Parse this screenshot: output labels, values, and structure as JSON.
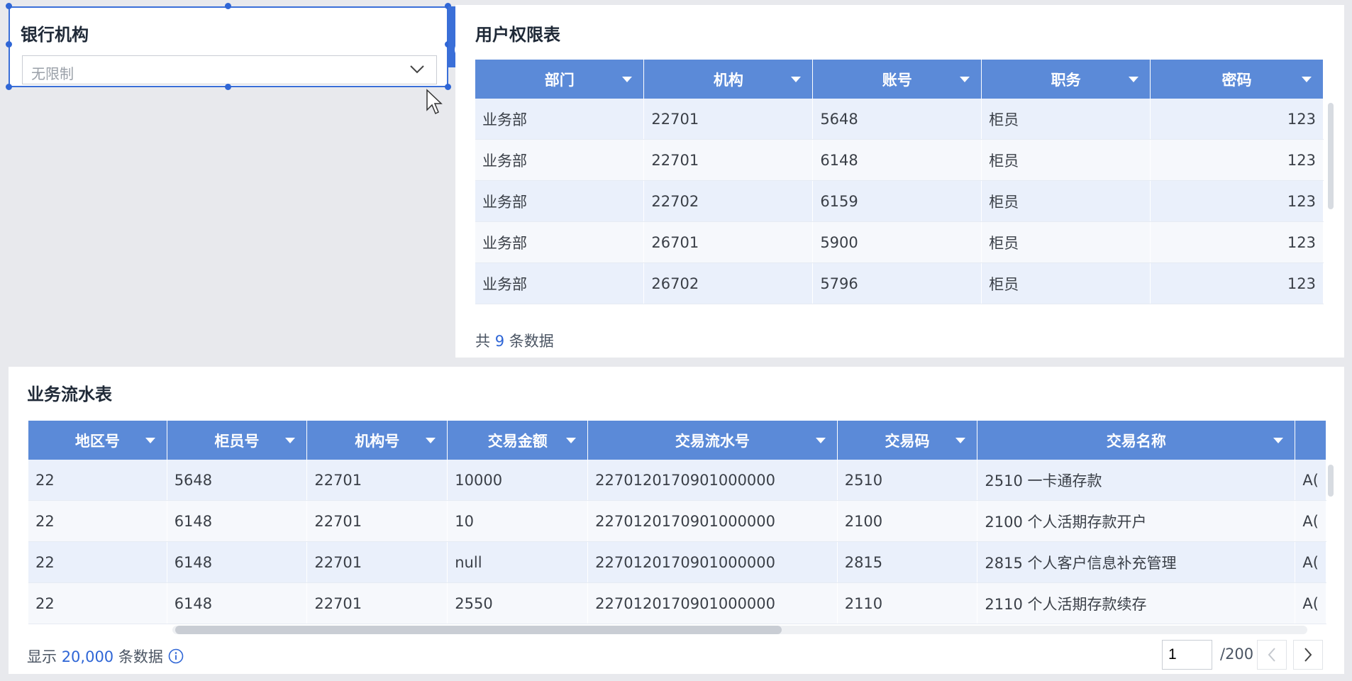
{
  "filter_widget": {
    "title": "银行机构",
    "selected_value": "无限制"
  },
  "user_table": {
    "title": "用户权限表",
    "columns": [
      "部门",
      "机构",
      "账号",
      "职务",
      "密码"
    ],
    "rows": [
      [
        "业务部",
        "22701",
        "5648",
        "柜员",
        "123"
      ],
      [
        "业务部",
        "22701",
        "6148",
        "柜员",
        "123"
      ],
      [
        "业务部",
        "22702",
        "6159",
        "柜员",
        "123"
      ],
      [
        "业务部",
        "26701",
        "5900",
        "柜员",
        "123"
      ],
      [
        "业务部",
        "26702",
        "5796",
        "柜员",
        "123"
      ]
    ],
    "footer": {
      "prefix": "共",
      "count": "9",
      "suffix": "条数据"
    }
  },
  "flow_table": {
    "title": "业务流水表",
    "columns": [
      "地区号",
      "柜员号",
      "机构号",
      "交易金额",
      "交易流水号",
      "交易码",
      "交易名称",
      ""
    ],
    "rows": [
      [
        "22",
        "5648",
        "22701",
        "10000",
        "2270120170901000000",
        "2510",
        "2510 一卡通存款",
        "A("
      ],
      [
        "22",
        "6148",
        "22701",
        "10",
        "2270120170901000000",
        "2100",
        "2100 个人活期存款开户",
        "A("
      ],
      [
        "22",
        "6148",
        "22701",
        "null",
        "2270120170901000000",
        "2815",
        "2815 个人客户信息补充管理",
        "A("
      ],
      [
        "22",
        "6148",
        "22701",
        "2550",
        "2270120170901000000",
        "2110",
        "2110 个人活期存款续存",
        "A("
      ]
    ],
    "footer": {
      "prefix": "显示",
      "count": "20,000",
      "suffix": "条数据"
    },
    "pager": {
      "current_page": "1",
      "total": "/200"
    }
  },
  "colors": {
    "accent": "#2f66d6",
    "header_bg": "#5b8ad8",
    "selection": "#3a6fd8",
    "canvas_bg": "#e8e9ed"
  },
  "icons": [
    "edit-icon",
    "chevron-circle-down-icon",
    "chevron-down-icon",
    "info-icon",
    "chevron-left-icon",
    "chevron-right-icon",
    "mouse-cursor-icon",
    "sort-triangle-icon"
  ]
}
